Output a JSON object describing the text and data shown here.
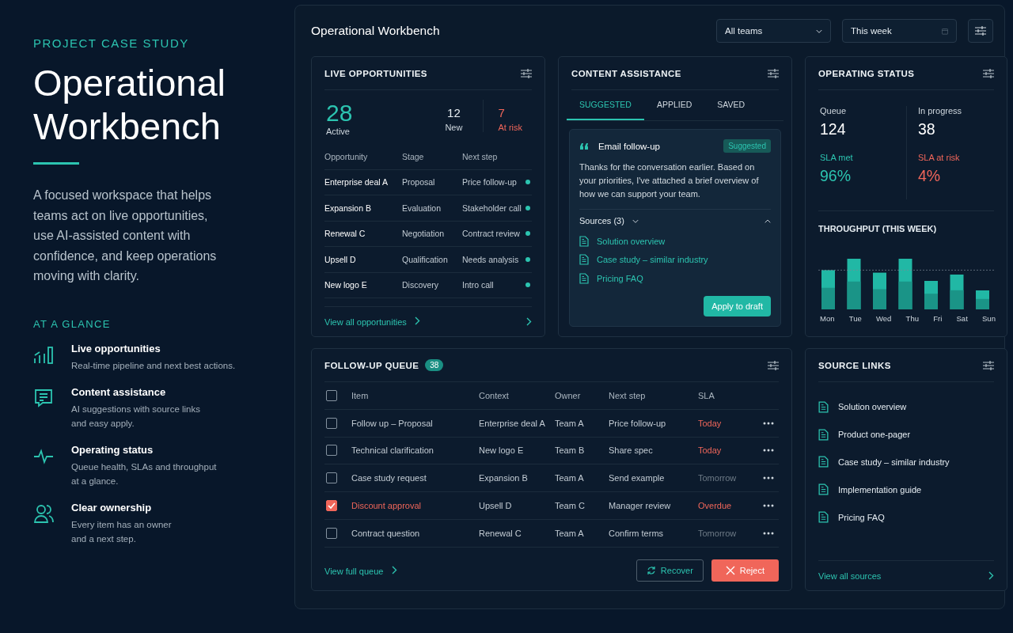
{
  "intro": {
    "eyebrow": "PROJECT CASE STUDY",
    "title": "Operational Workbench",
    "description": "A focused workspace that helps teams act on live opportunities, use AI-assisted content with confidence, and keep operations moving with clarity.",
    "glance_heading": "AT A GLANCE",
    "glance": [
      {
        "kind": "chart",
        "title": "Live opportunities",
        "lines": [
          "Real-time pipeline and next best actions."
        ]
      },
      {
        "kind": "note",
        "title": "Content assistance",
        "lines": [
          "AI suggestions with source links",
          "and easy apply."
        ]
      },
      {
        "kind": "pulse",
        "title": "Operating status",
        "lines": [
          "Queue health, SLAs and throughput",
          "at a glance."
        ]
      },
      {
        "kind": "people",
        "title": "Clear ownership",
        "lines": [
          "Every item has an owner",
          "and a next step."
        ]
      }
    ]
  },
  "workbench": {
    "title": "Operational Workbench",
    "filters": [
      {
        "kind": "select",
        "value": "All teams"
      },
      {
        "kind": "date",
        "value": "This week"
      }
    ],
    "live_opportunities": {
      "title": "LIVE OPPORTUNITIES",
      "active": {
        "value": "28",
        "label": "Active"
      },
      "new": {
        "value": "12",
        "label": "New"
      },
      "at_risk": {
        "value": "7",
        "label": "At risk"
      },
      "columns": [
        "Opportunity",
        "Stage",
        "Next step"
      ],
      "rows": [
        {
          "opportunity": "Enterprise deal A",
          "stage": "Proposal",
          "next_step": "Price follow-up",
          "color": "#2cc4b0"
        },
        {
          "opportunity": "Expansion B",
          "stage": "Evaluation",
          "next_step": "Stakeholder call",
          "color": "#2cc4b0"
        },
        {
          "opportunity": "Renewal C",
          "stage": "Negotiation",
          "next_step": "Contract review",
          "color": "#2cc4b0"
        },
        {
          "opportunity": "Upsell D",
          "stage": "Qualification",
          "next_step": "Needs analysis",
          "color": "#2cc4b0"
        },
        {
          "opportunity": "New logo E",
          "stage": "Discovery",
          "next_step": "Intro call",
          "color": "#2cc4b0"
        }
      ],
      "link": "View all opportunities"
    },
    "content_assistance": {
      "title": "CONTENT ASSISTANCE",
      "tabs": [
        {
          "label": "SUGGESTED",
          "selected": true
        },
        {
          "label": "APPLIED",
          "selected": false
        },
        {
          "label": "SAVED",
          "selected": false
        }
      ],
      "suggestion": {
        "title": "Email follow-up",
        "badge": "Suggested",
        "body": "Thanks for the conversation earlier. Based on your priorities, I've attached a brief overview of how we can support your team.",
        "sources_label": "Sources (3)",
        "expanded": true,
        "sources": [
          "Solution overview",
          "Case study – similar industry",
          "Pricing FAQ"
        ],
        "action": "Apply to draft"
      }
    },
    "operating_status": {
      "title": "OPERATING STATUS",
      "metrics": [
        {
          "label": "Queue",
          "value": "124",
          "color": "#ffffff"
        },
        {
          "label": "In progress",
          "value": "38",
          "color": "#ffffff"
        },
        {
          "label": "SLA met",
          "value": "96%",
          "color": "#2cc4b0"
        },
        {
          "label": "SLA at risk",
          "value": "4%",
          "color": "#f0665a"
        }
      ],
      "throughput_title": "THROUGHPUT (THIS WEEK)",
      "days": [
        "Mon",
        "Tue",
        "Wed",
        "Thu",
        "Fri",
        "Sat",
        "Sun"
      ]
    },
    "follow_up_queue": {
      "title": "FOLLOW-UP QUEUE",
      "count": "38",
      "all_checked": false,
      "columns": [
        "Item",
        "Context",
        "Owner",
        "Next step",
        "SLA"
      ],
      "rows": [
        {
          "item": "Follow up – Proposal",
          "context": "Enterprise deal A",
          "owner": "Team A",
          "next_step": "Price follow-up",
          "sla": "Today",
          "color": "#f0665a",
          "checked": false
        },
        {
          "item": "Technical clarification",
          "context": "New logo E",
          "owner": "Team B",
          "next_step": "Share spec",
          "sla": "Today",
          "color": "#f0665a",
          "checked": false
        },
        {
          "item": "Case study request",
          "context": "Expansion B",
          "owner": "Team A",
          "next_step": "Send example",
          "sla": "Tomorrow",
          "color": "#6e7b87",
          "checked": false
        },
        {
          "item": "Discount approval",
          "context": "Upsell D",
          "owner": "Team C",
          "next_step": "Manager review",
          "sla": "Overdue",
          "color": "#f0665a",
          "checked": true
        },
        {
          "item": "Contract question",
          "context": "Renewal C",
          "owner": "Team A",
          "next_step": "Confirm terms",
          "sla": "Tomorrow",
          "color": "#6e7b87",
          "checked": false
        }
      ],
      "link": "View full queue",
      "buttons": [
        {
          "kind": "recover",
          "label": "Recover"
        },
        {
          "kind": "reject",
          "label": "Reject"
        }
      ]
    },
    "source_links": {
      "title": "SOURCE LINKS",
      "items": [
        "Solution overview",
        "Product one-pager",
        "Case study – similar industry",
        "Implementation guide",
        "Pricing FAQ"
      ],
      "link": "View all sources"
    }
  }
}
